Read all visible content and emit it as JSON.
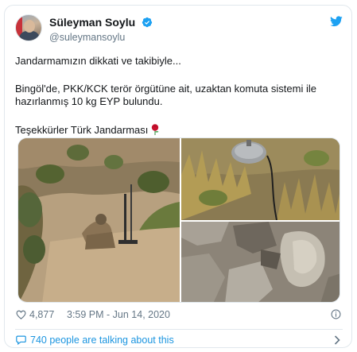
{
  "tweet": {
    "author": {
      "display_name": "Süleyman Soylu",
      "handle": "@suleymansoylu",
      "verified_icon": "verified-badge-icon",
      "avatar": "avatar"
    },
    "brand_icon": "twitter-bird-icon",
    "lines": [
      "Jandarmamızın dikkati ve takibiyle...",
      "Bingöl'de, PKK/KCK terör örgütüne ait, uzaktan komuta sistemi ile hazırlanmış 10 kg EYP bulundu.",
      "Teşekkürler Türk Jandarması"
    ],
    "emoji": "rose-emoji",
    "media": {
      "photos": [
        "soldier-with-device-photo",
        "buried-device-photo",
        "rocky-soil-photo"
      ]
    },
    "meta": {
      "likes": "4,877",
      "timestamp": "3:59 PM - Jun 14, 2020",
      "info_icon": "info-icon"
    },
    "conversation": {
      "label": "740 people are talking about this"
    }
  },
  "colors": {
    "text": "#14171a",
    "secondary": "#657786",
    "accent": "#1b95e0",
    "border": "#e1e8ed"
  }
}
